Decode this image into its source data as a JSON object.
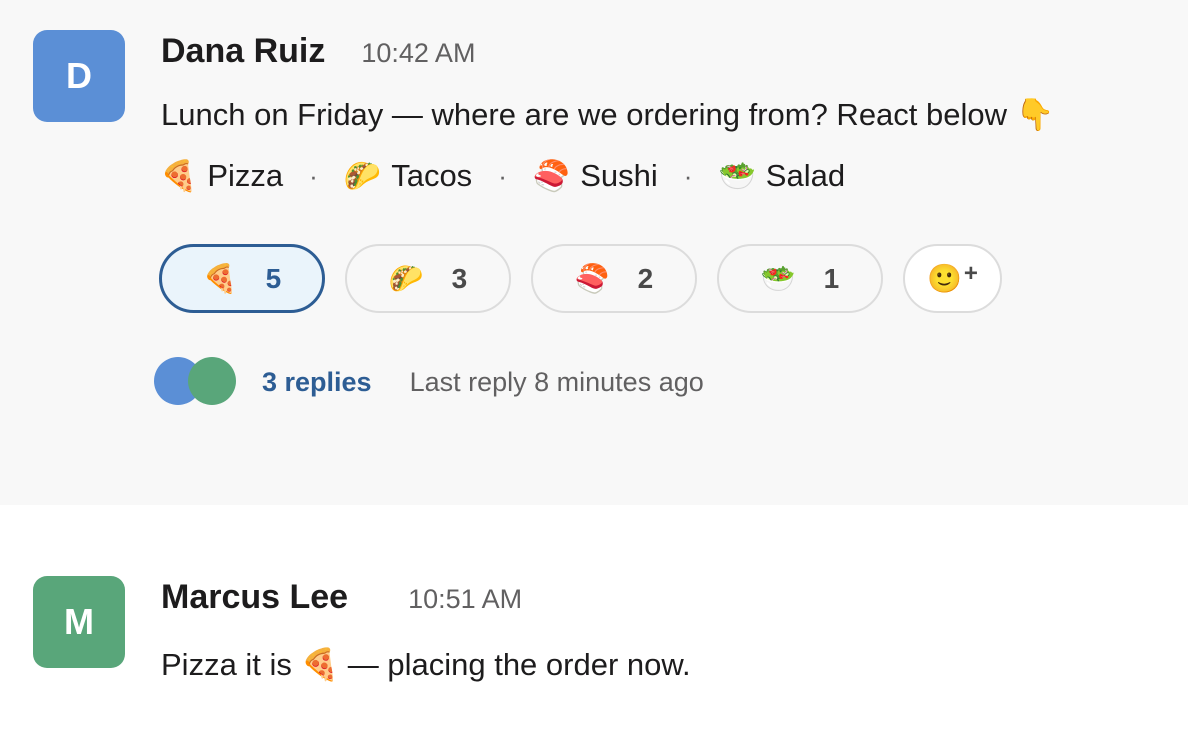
{
  "messages": [
    {
      "avatar_initial": "D",
      "author": "Dana Ruiz",
      "time": "10:42 AM",
      "text": "Lunch on Friday — where are we ordering from? React below 👇",
      "options": [
        {
          "emoji": "🍕",
          "label": "Pizza"
        },
        {
          "emoji": "🌮",
          "label": "Tacos"
        },
        {
          "emoji": "🍣",
          "label": "Sushi"
        },
        {
          "emoji": "🥗",
          "label": "Salad"
        }
      ],
      "separator": "·",
      "reactions": [
        {
          "emoji": "🍕",
          "count": "5",
          "active": true
        },
        {
          "emoji": "🌮",
          "count": "3",
          "active": false
        },
        {
          "emoji": "🍣",
          "count": "2",
          "active": false
        },
        {
          "emoji": "🥗",
          "count": "1",
          "active": false
        }
      ],
      "add_reaction": {
        "emoji": "🙂",
        "plus": "+"
      },
      "thread": {
        "replies_label": "3 replies",
        "last_reply": "Last reply 8 minutes ago"
      }
    },
    {
      "avatar_initial": "M",
      "author": "Marcus Lee",
      "time": "10:51 AM",
      "text": "Pizza it is 🍕 — placing the order now."
    }
  ],
  "colors": {
    "avatar_dana": "#5b8fd6",
    "avatar_marcus": "#59a67a",
    "accent": "#2d5d94",
    "active_reaction_bg": "#eaf4fb"
  }
}
